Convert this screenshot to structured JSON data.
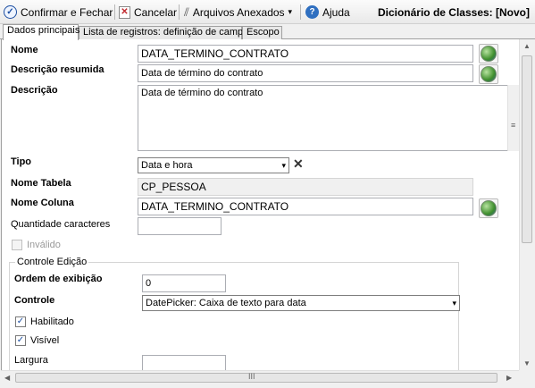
{
  "toolbar": {
    "confirm_label": "Confirmar e Fechar",
    "cancel_label": "Cancelar",
    "attachments_label": "Arquivos Anexados",
    "help_label": "Ajuda",
    "window_title": "Dicionário de Classes: [Novo]"
  },
  "tabs": [
    {
      "label": "Dados principais",
      "active": true
    },
    {
      "label": "Lista de registros: definição de campos",
      "active": false
    },
    {
      "label": "Escopo",
      "active": false
    }
  ],
  "form": {
    "nome": {
      "label": "Nome",
      "value": "DATA_TERMINO_CONTRATO"
    },
    "descricao_resumida": {
      "label": "Descrição resumida",
      "value": "Data de término do contrato"
    },
    "descricao": {
      "label": "Descrição",
      "value": "Data de término do contrato"
    },
    "tipo": {
      "label": "Tipo",
      "value": "Data e hora"
    },
    "nome_tabela": {
      "label": "Nome Tabela",
      "value": "CP_PESSOA"
    },
    "nome_coluna": {
      "label": "Nome Coluna",
      "value": "DATA_TERMINO_CONTRATO"
    },
    "quantidade": {
      "label": "Quantidade caracteres",
      "value": ""
    },
    "invalido": {
      "label": "Inválido",
      "checked": false
    }
  },
  "controle_edicao": {
    "title": "Controle Edição",
    "ordem": {
      "label": "Ordem de exibição",
      "value": "0"
    },
    "controle": {
      "label": "Controle",
      "value": "DatePicker: Caixa de texto para data"
    },
    "habilitado": {
      "label": "Habilitado",
      "checked": true
    },
    "visivel": {
      "label": "Visível",
      "checked": true
    },
    "largura": {
      "label": "Largura",
      "value": ""
    }
  },
  "glyphs": {
    "check": "✓",
    "cancel": "✕",
    "clip": "⫽",
    "question": "?",
    "dropdown": "▾",
    "clear": "✕",
    "hgrip": "III",
    "vgrip": "≡",
    "arrow_up": "▲",
    "arrow_down": "▼",
    "arrow_left": "◀",
    "arrow_right": "▶"
  },
  "colors": {
    "accent": "#1c4ea1",
    "cancel_red": "#c0282d",
    "help_blue": "#2f6fc0"
  }
}
